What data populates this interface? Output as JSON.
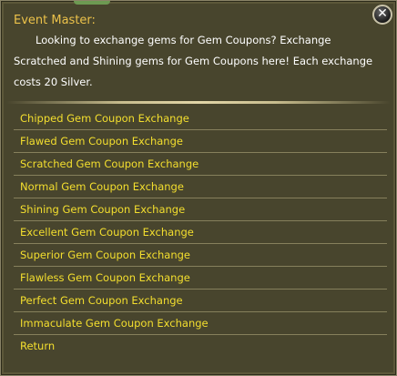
{
  "dialog": {
    "speaker": "Event Master:",
    "message_lines": [
      "Looking to exchange gems for Gem Coupons? Exchange",
      "Scratched and Shining gems for Gem Coupons here! Each exchange",
      "costs 20 Silver."
    ],
    "close_symbol": "✕",
    "options": [
      "Chipped Gem Coupon Exchange",
      "Flawed Gem Coupon Exchange",
      "Scratched Gem Coupon Exchange",
      "Normal Gem Coupon Exchange",
      "Shining Gem Coupon Exchange",
      "Excellent Gem Coupon Exchange",
      "Superior Gem Coupon Exchange",
      "Flawless Gem Coupon Exchange",
      "Perfect Gem Coupon Exchange",
      "Immaculate Gem Coupon Exchange",
      "Return"
    ]
  },
  "colors": {
    "panel_background": "#48452d",
    "speaker_text": "#ecc24a",
    "message_text": "#ffffff",
    "option_text": "#f4df2e",
    "divider": "#c8bd8e"
  },
  "icons": {
    "close": "close-icon"
  }
}
